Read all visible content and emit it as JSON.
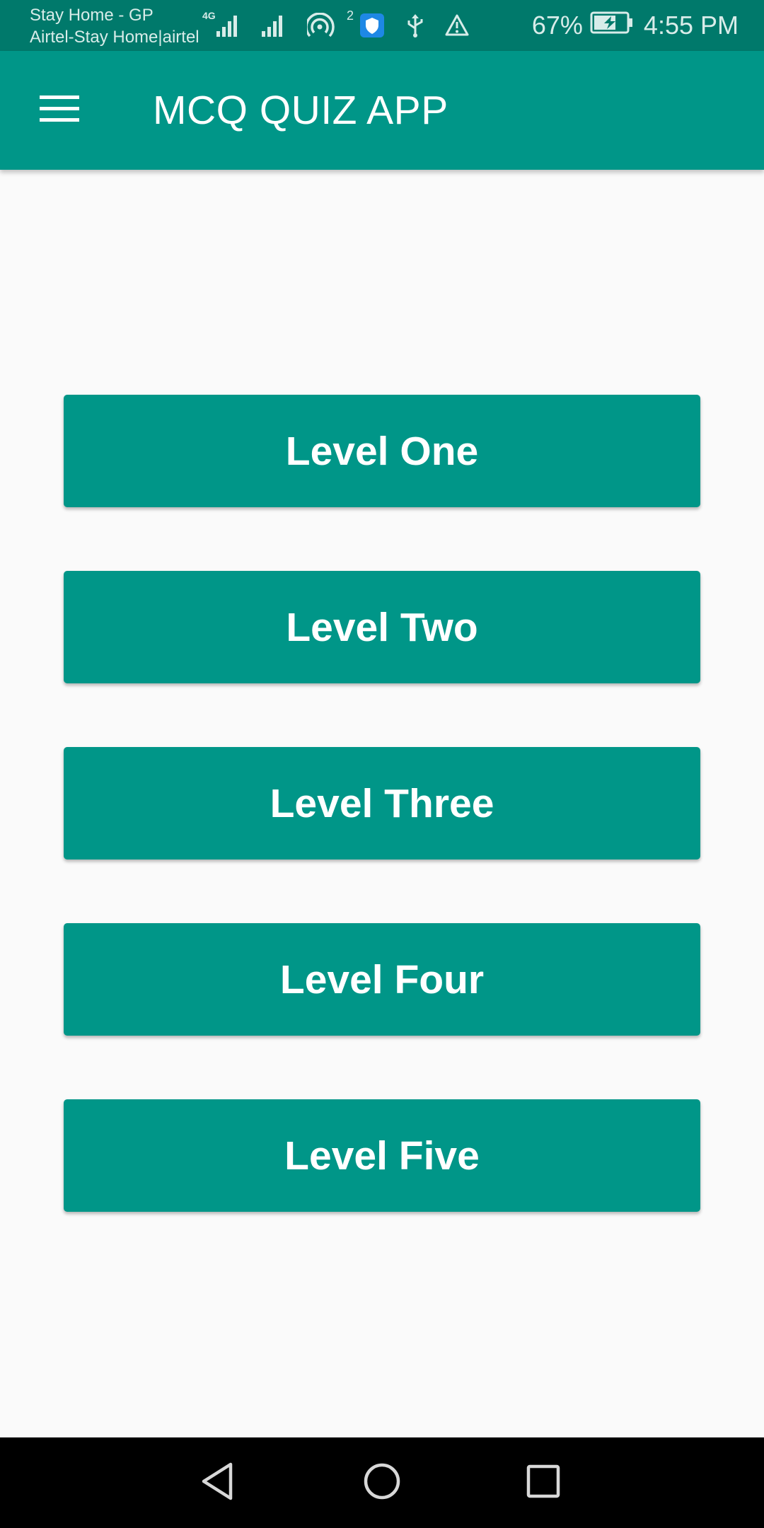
{
  "status_bar": {
    "carrier_line1": "Stay Home - GP",
    "carrier_line2": "Airtel-Stay Home|airtel",
    "network_type": "4G",
    "hotspot_badge": "2",
    "battery_percent": "67%",
    "time": "4:55 PM",
    "icons": [
      "signal-icon",
      "signal-icon",
      "hotspot-icon",
      "shield-icon",
      "usb-icon",
      "warning-icon",
      "battery-charging-icon"
    ]
  },
  "app_bar": {
    "title": "MCQ QUIZ APP",
    "menu_icon": "hamburger-menu-icon"
  },
  "levels": [
    {
      "label": "Level One"
    },
    {
      "label": "Level Two"
    },
    {
      "label": "Level Three"
    },
    {
      "label": "Level Four"
    },
    {
      "label": "Level Five"
    }
  ],
  "nav_bar": {
    "icons": [
      "back-icon",
      "home-icon",
      "recents-icon"
    ]
  },
  "colors": {
    "status_bar": "#00796b",
    "primary": "#009688",
    "background": "#fafafa",
    "nav_bar": "#000000",
    "text_on_primary": "#ffffff"
  }
}
